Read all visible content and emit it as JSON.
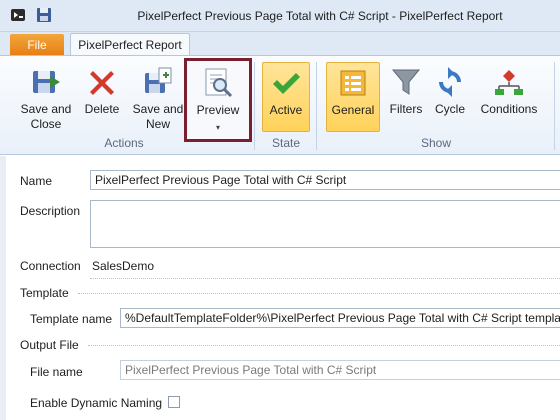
{
  "window": {
    "title": "PixelPerfect Previous Page Total with C# Script - PixelPerfect Report"
  },
  "tabs": {
    "file": "File",
    "active": "PixelPerfect Report"
  },
  "ribbon": {
    "actions": {
      "group_label": "Actions",
      "save_close": "Save and Close",
      "delete": "Delete",
      "save_new": "Save and New",
      "preview": "Preview",
      "preview_arrow": "▾"
    },
    "state": {
      "group_label": "State",
      "active": "Active"
    },
    "show": {
      "group_label": "Show",
      "general": "General",
      "filters": "Filters",
      "cycle": "Cycle",
      "conditions": "Conditions"
    }
  },
  "form": {
    "name_label": "Name",
    "name_value": "PixelPerfect Previous Page Total with C# Script",
    "description_label": "Description",
    "description_value": "",
    "connection_label": "Connection",
    "connection_value": "SalesDemo",
    "template_section": "Template",
    "template_name_label": "Template name",
    "template_name_value": "%DefaultTemplateFolder%\\PixelPerfect Previous Page Total with C# Script template",
    "output_section": "Output File",
    "file_name_label": "File name",
    "file_name_value": "PixelPerfect Previous Page Total with C# Script",
    "dynamic_naming_label": "Enable Dynamic Naming",
    "dynamic_naming_checked": false
  },
  "colors": {
    "ribbon_bg": "#e9f0f9",
    "file_tab": "#e67e12",
    "highlight": "#ffd25a",
    "preview_outline": "#7a1f2f"
  }
}
